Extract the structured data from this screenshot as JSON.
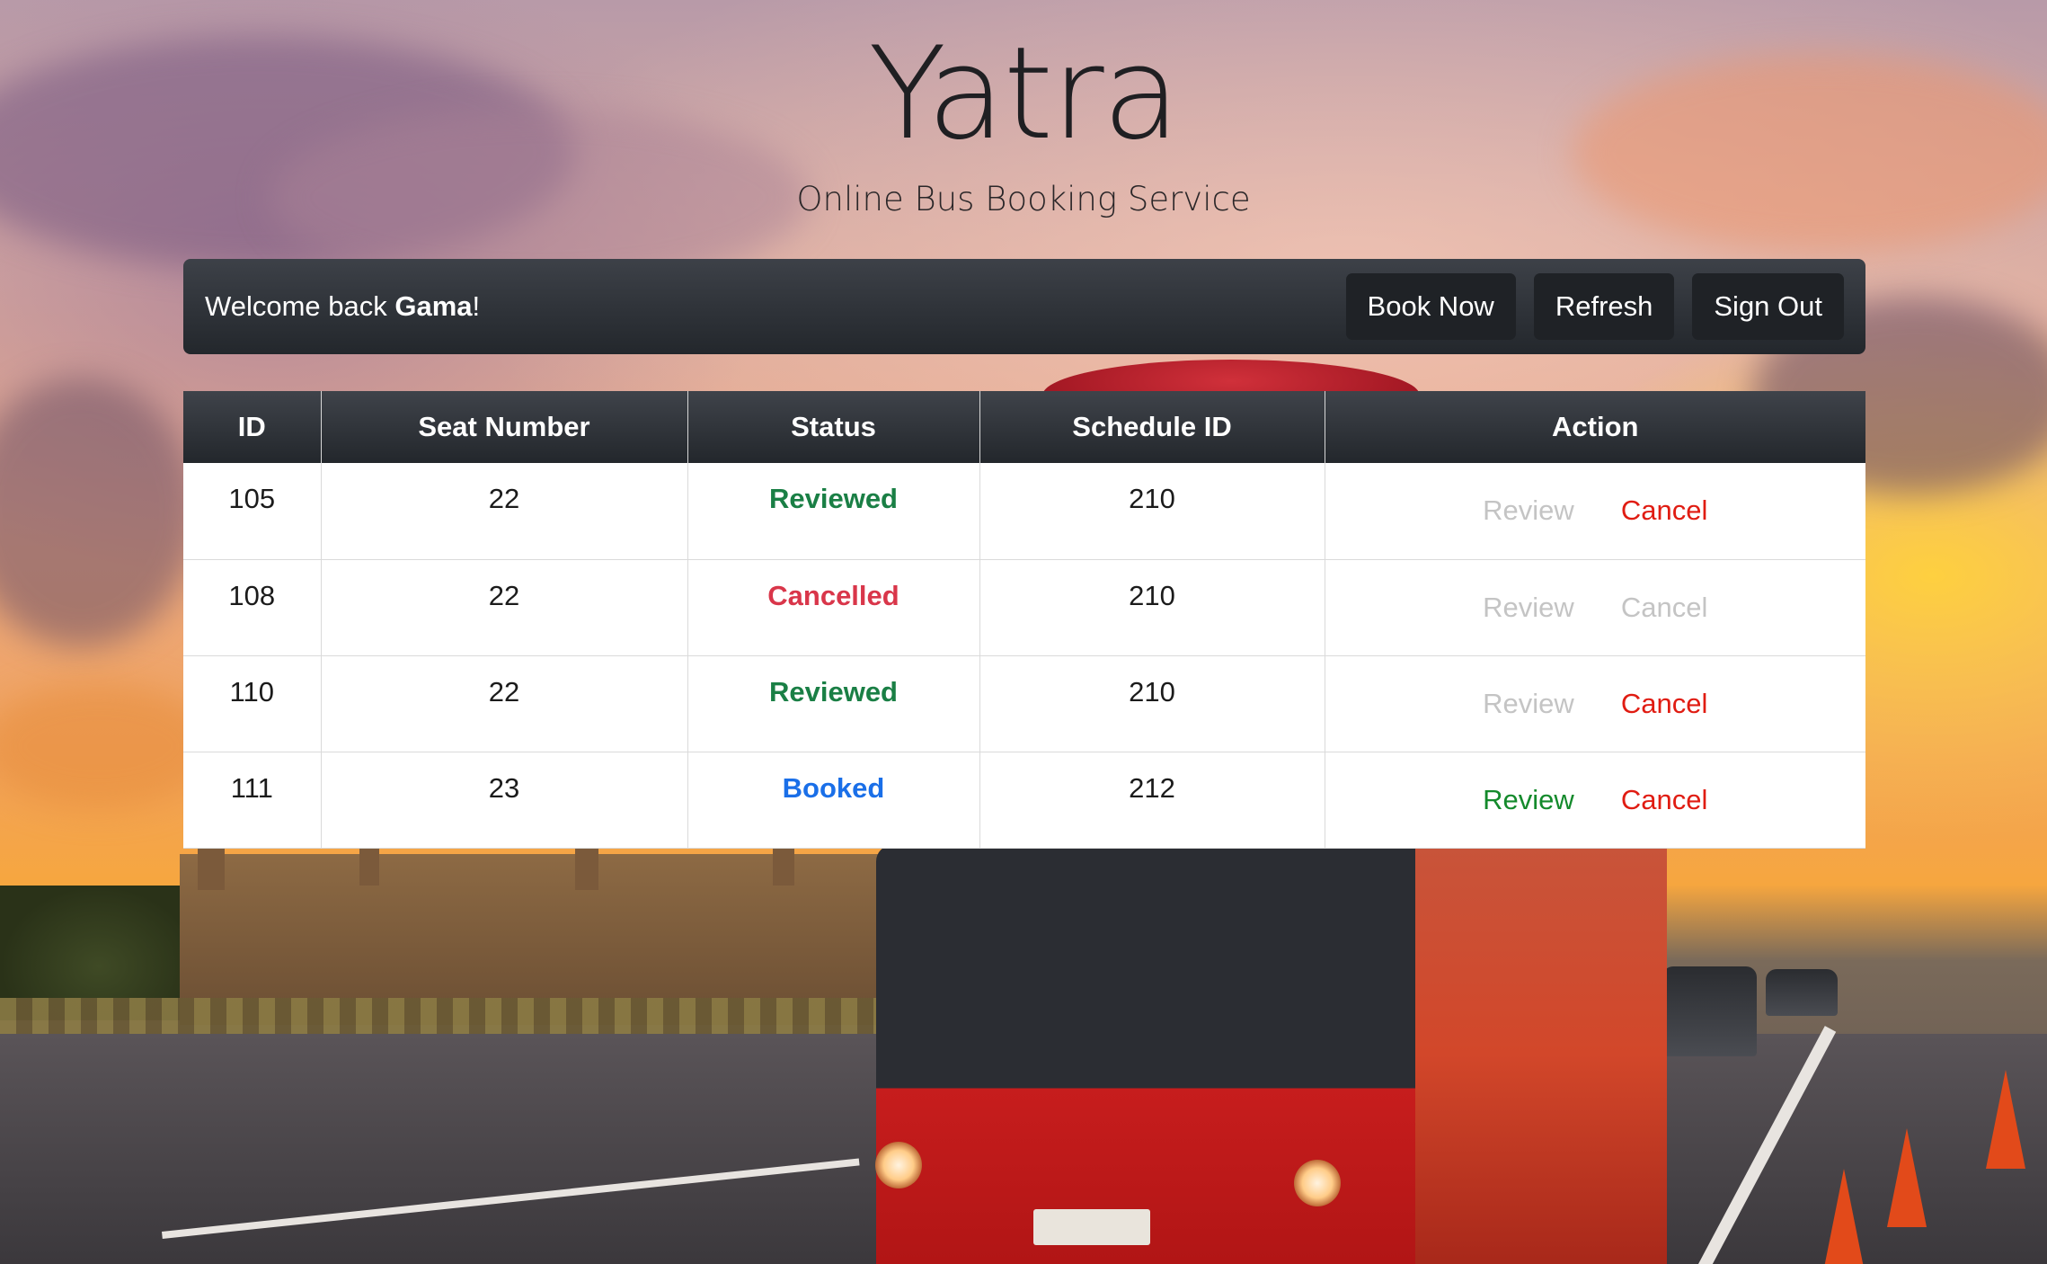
{
  "header": {
    "title": "Yatra",
    "subtitle": "Online Bus Booking Service"
  },
  "navbar": {
    "welcome_prefix": "Welcome back ",
    "user_name": "Gama",
    "welcome_suffix": "!",
    "buttons": {
      "book_now": "Book Now",
      "refresh": "Refresh",
      "sign_out": "Sign Out"
    }
  },
  "table": {
    "columns": [
      "ID",
      "Seat Number",
      "Status",
      "Schedule ID",
      "Action"
    ],
    "action_labels": {
      "review": "Review",
      "cancel": "Cancel"
    },
    "rows": [
      {
        "id": "105",
        "seat": "22",
        "status": "Reviewed",
        "schedule": "210",
        "review_enabled": false,
        "cancel_enabled": true
      },
      {
        "id": "108",
        "seat": "22",
        "status": "Cancelled",
        "schedule": "210",
        "review_enabled": false,
        "cancel_enabled": false
      },
      {
        "id": "110",
        "seat": "22",
        "status": "Reviewed",
        "schedule": "210",
        "review_enabled": false,
        "cancel_enabled": true
      },
      {
        "id": "111",
        "seat": "23",
        "status": "Booked",
        "schedule": "212",
        "review_enabled": true,
        "cancel_enabled": true
      }
    ]
  },
  "colors": {
    "status_reviewed": "#1a7f45",
    "status_cancelled": "#d9364a",
    "status_booked": "#1a6fe8",
    "action_review_enabled": "#148a2c",
    "action_cancel_enabled": "#e01c12",
    "action_disabled": "#c4c4c4",
    "navbar_bg": "#2b2f35"
  }
}
